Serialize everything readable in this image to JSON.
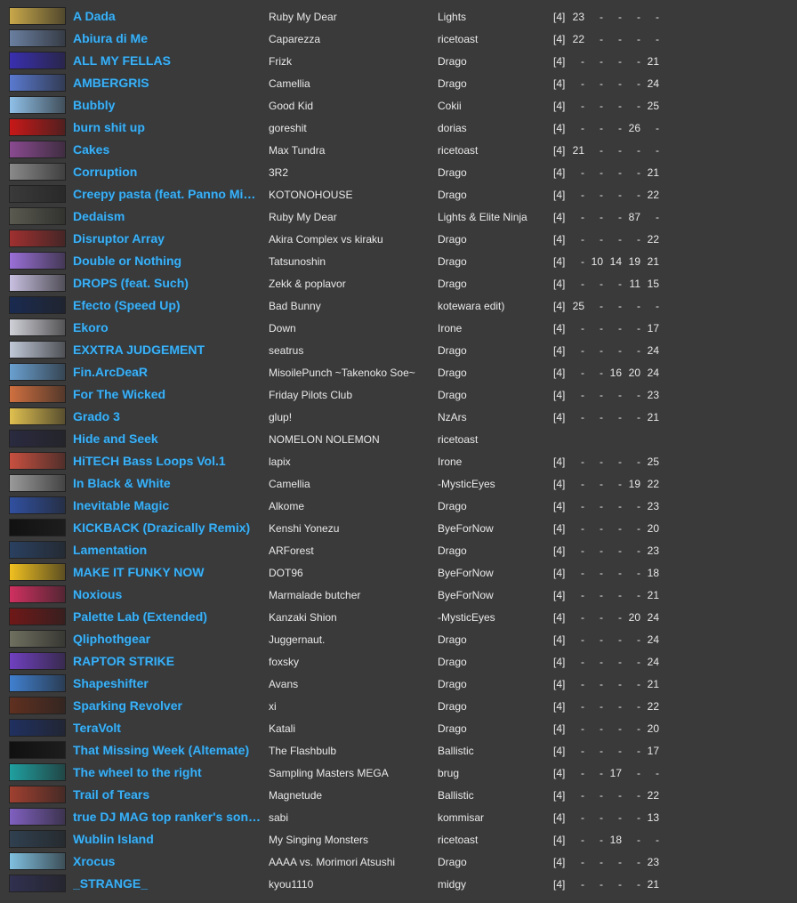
{
  "songs": [
    {
      "title": "A Dada",
      "artist": "Ruby My Dear",
      "charter": "Lights",
      "keys": "[4]",
      "levels": [
        "23",
        "-",
        "-",
        "-",
        "-"
      ],
      "thumb": "#c8a84a"
    },
    {
      "title": "Abiura di Me",
      "artist": "Caparezza",
      "charter": "ricetoast",
      "keys": "[4]",
      "levels": [
        "22",
        "-",
        "-",
        "-",
        "-"
      ],
      "thumb": "#6a7fa0"
    },
    {
      "title": "ALL MY FELLAS",
      "artist": "Frizk",
      "charter": "Drago",
      "keys": "[4]",
      "levels": [
        "-",
        "-",
        "-",
        "-",
        "21"
      ],
      "thumb": "#3a2fb0"
    },
    {
      "title": "AMBERGRIS",
      "artist": "Camellia",
      "charter": "Drago",
      "keys": "[4]",
      "levels": [
        "-",
        "-",
        "-",
        "-",
        "24"
      ],
      "thumb": "#5a7ad0"
    },
    {
      "title": "Bubbly",
      "artist": "Good Kid",
      "charter": "Cokii",
      "keys": "[4]",
      "levels": [
        "-",
        "-",
        "-",
        "-",
        "25"
      ],
      "thumb": "#8fc0e8"
    },
    {
      "title": "burn shit up",
      "artist": "goreshit",
      "charter": "dorias",
      "keys": "[4]",
      "levels": [
        "-",
        "-",
        "-",
        "26",
        "-"
      ],
      "thumb": "#c81818"
    },
    {
      "title": "Cakes",
      "artist": "Max Tundra",
      "charter": "ricetoast",
      "keys": "[4]",
      "levels": [
        "21",
        "-",
        "-",
        "-",
        "-"
      ],
      "thumb": "#8a4a90"
    },
    {
      "title": "Corruption",
      "artist": "3R2",
      "charter": "Drago",
      "keys": "[4]",
      "levels": [
        "-",
        "-",
        "-",
        "-",
        "21"
      ],
      "thumb": "#8a8a8a"
    },
    {
      "title": "Creepy pasta (feat. Panno Mimi)",
      "artist": "KOTONOHOUSE",
      "charter": "Drago",
      "keys": "[4]",
      "levels": [
        "-",
        "-",
        "-",
        "-",
        "22"
      ],
      "thumb": "#3a3a3a"
    },
    {
      "title": "Dedaism",
      "artist": "Ruby My Dear",
      "charter": "Lights & Elite Ninja",
      "keys": "[4]",
      "levels": [
        "-",
        "-",
        "-",
        "87",
        "-"
      ],
      "thumb": "#5a5a50"
    },
    {
      "title": "Disruptor Array",
      "artist": "Akira Complex vs kiraku",
      "charter": "Drago",
      "keys": "[4]",
      "levels": [
        "-",
        "-",
        "-",
        "-",
        "22"
      ],
      "thumb": "#a03030"
    },
    {
      "title": "Double or Nothing",
      "artist": "Tatsunoshin",
      "charter": "Drago",
      "keys": "[4]",
      "levels": [
        "-",
        "10",
        "14",
        "19",
        "21"
      ],
      "thumb": "#9a70d8"
    },
    {
      "title": "DROPS (feat. Such)",
      "artist": "Zekk & poplavor",
      "charter": "Drago",
      "keys": "[4]",
      "levels": [
        "-",
        "-",
        "-",
        "11",
        "15"
      ],
      "thumb": "#c8c0e0"
    },
    {
      "title": "Efecto (Speed Up)",
      "artist": "Bad Bunny",
      "charter": "kotewara edit)",
      "keys": "[4]",
      "levels": [
        "25",
        "-",
        "-",
        "-",
        "-"
      ],
      "thumb": "#1a2a50"
    },
    {
      "title": "Ekoro",
      "artist": "Down",
      "charter": "Irone",
      "keys": "[4]",
      "levels": [
        "-",
        "-",
        "-",
        "-",
        "17"
      ],
      "thumb": "#d0d0d8"
    },
    {
      "title": "EXXTRA JUDGEMENT",
      "artist": "seatrus",
      "charter": "Drago",
      "keys": "[4]",
      "levels": [
        "-",
        "-",
        "-",
        "-",
        "24"
      ],
      "thumb": "#c0c8d8"
    },
    {
      "title": "Fin.ArcDeaR",
      "artist": "MisoilePunch ~Takenoko Soe~",
      "charter": "Drago",
      "keys": "[4]",
      "levels": [
        "-",
        "-",
        "16",
        "20",
        "24"
      ],
      "thumb": "#6aa0d0"
    },
    {
      "title": "For The Wicked",
      "artist": "Friday Pilots Club",
      "charter": "Drago",
      "keys": "[4]",
      "levels": [
        "-",
        "-",
        "-",
        "-",
        "23"
      ],
      "thumb": "#d07040"
    },
    {
      "title": "Grado 3",
      "artist": "glup!",
      "charter": "NzArs",
      "keys": "[4]",
      "levels": [
        "-",
        "-",
        "-",
        "-",
        "21"
      ],
      "thumb": "#e0c050"
    },
    {
      "title": "Hide and Seek",
      "artist": "NOMELON NOLEMON",
      "charter": "ricetoast",
      "keys": "",
      "levels": [
        "",
        "",
        "",
        "",
        ""
      ],
      "thumb": "#2a2a40"
    },
    {
      "title": "HiTECH Bass Loops Vol.1",
      "artist": "lapix",
      "charter": "Irone",
      "keys": "[4]",
      "levels": [
        "-",
        "-",
        "-",
        "-",
        "25"
      ],
      "thumb": "#c85040"
    },
    {
      "title": "In Black & White",
      "artist": "Camellia",
      "charter": "-MysticEyes",
      "keys": "[4]",
      "levels": [
        "-",
        "-",
        "-",
        "19",
        "22"
      ],
      "thumb": "#9a9a9a"
    },
    {
      "title": "Inevitable Magic",
      "artist": "Alkome",
      "charter": "Drago",
      "keys": "[4]",
      "levels": [
        "-",
        "-",
        "-",
        "-",
        "23"
      ],
      "thumb": "#3050a0"
    },
    {
      "title": "KICKBACK (Drazically Remix)",
      "artist": "Kenshi Yonezu",
      "charter": "ByeForNow",
      "keys": "[4]",
      "levels": [
        "-",
        "-",
        "-",
        "-",
        "20"
      ],
      "thumb": "#111111"
    },
    {
      "title": "Lamentation",
      "artist": "ARForest",
      "charter": "Drago",
      "keys": "[4]",
      "levels": [
        "-",
        "-",
        "-",
        "-",
        "23"
      ],
      "thumb": "#2a4060"
    },
    {
      "title": "MAKE IT FUNKY NOW",
      "artist": "DOT96",
      "charter": "ByeForNow",
      "keys": "[4]",
      "levels": [
        "-",
        "-",
        "-",
        "-",
        "18"
      ],
      "thumb": "#f0c020"
    },
    {
      "title": "Noxious",
      "artist": "Marmalade butcher",
      "charter": "ByeForNow",
      "keys": "[4]",
      "levels": [
        "-",
        "-",
        "-",
        "-",
        "21"
      ],
      "thumb": "#d03060"
    },
    {
      "title": "Palette Lab (Extended)",
      "artist": "Kanzaki Shion",
      "charter": "-MysticEyes",
      "keys": "[4]",
      "levels": [
        "-",
        "-",
        "-",
        "20",
        "24"
      ],
      "thumb": "#701818"
    },
    {
      "title": "Qliphothgear",
      "artist": "Juggernaut.",
      "charter": "Drago",
      "keys": "[4]",
      "levels": [
        "-",
        "-",
        "-",
        "-",
        "24"
      ],
      "thumb": "#707060"
    },
    {
      "title": "RAPTOR STRIKE",
      "artist": "foxsky",
      "charter": "Drago",
      "keys": "[4]",
      "levels": [
        "-",
        "-",
        "-",
        "-",
        "24"
      ],
      "thumb": "#7040c0"
    },
    {
      "title": "Shapeshifter",
      "artist": "Avans",
      "charter": "Drago",
      "keys": "[4]",
      "levels": [
        "-",
        "-",
        "-",
        "-",
        "21"
      ],
      "thumb": "#4080d0"
    },
    {
      "title": "Sparking Revolver",
      "artist": "xi",
      "charter": "Drago",
      "keys": "[4]",
      "levels": [
        "-",
        "-",
        "-",
        "-",
        "22"
      ],
      "thumb": "#603020"
    },
    {
      "title": "TeraVolt",
      "artist": "Katali",
      "charter": "Drago",
      "keys": "[4]",
      "levels": [
        "-",
        "-",
        "-",
        "-",
        "20"
      ],
      "thumb": "#203060"
    },
    {
      "title": "That Missing Week (Altemate)",
      "artist": "The Flashbulb",
      "charter": "Ballistic",
      "keys": "[4]",
      "levels": [
        "-",
        "-",
        "-",
        "-",
        "17"
      ],
      "thumb": "#101010"
    },
    {
      "title": "The wheel to the right",
      "artist": "Sampling Masters MEGA",
      "charter": "brug",
      "keys": "[4]",
      "levels": [
        "-",
        "-",
        "17",
        "-",
        "-"
      ],
      "thumb": "#20a0a0"
    },
    {
      "title": "Trail of Tears",
      "artist": "Magnetude",
      "charter": "Ballistic",
      "keys": "[4]",
      "levels": [
        "-",
        "-",
        "-",
        "-",
        "22"
      ],
      "thumb": "#a04030"
    },
    {
      "title": "true DJ MAG top ranker's song Zenpen",
      "artist": "sabi",
      "charter": "kommisar",
      "keys": "[4]",
      "levels": [
        "-",
        "-",
        "-",
        "-",
        "13"
      ],
      "thumb": "#8060c0"
    },
    {
      "title": "Wublin Island",
      "artist": "My Singing Monsters",
      "charter": "ricetoast",
      "keys": "[4]",
      "levels": [
        "-",
        "-",
        "18",
        "-",
        "-"
      ],
      "thumb": "#304050"
    },
    {
      "title": "Xrocus",
      "artist": "AAAA vs. Morimori Atsushi",
      "charter": "Drago",
      "keys": "[4]",
      "levels": [
        "-",
        "-",
        "-",
        "-",
        "23"
      ],
      "thumb": "#80c0e0"
    },
    {
      "title": "_STRANGE_",
      "artist": "kyou1110",
      "charter": "midgy",
      "keys": "[4]",
      "levels": [
        "-",
        "-",
        "-",
        "-",
        "21"
      ],
      "thumb": "#303050"
    }
  ]
}
